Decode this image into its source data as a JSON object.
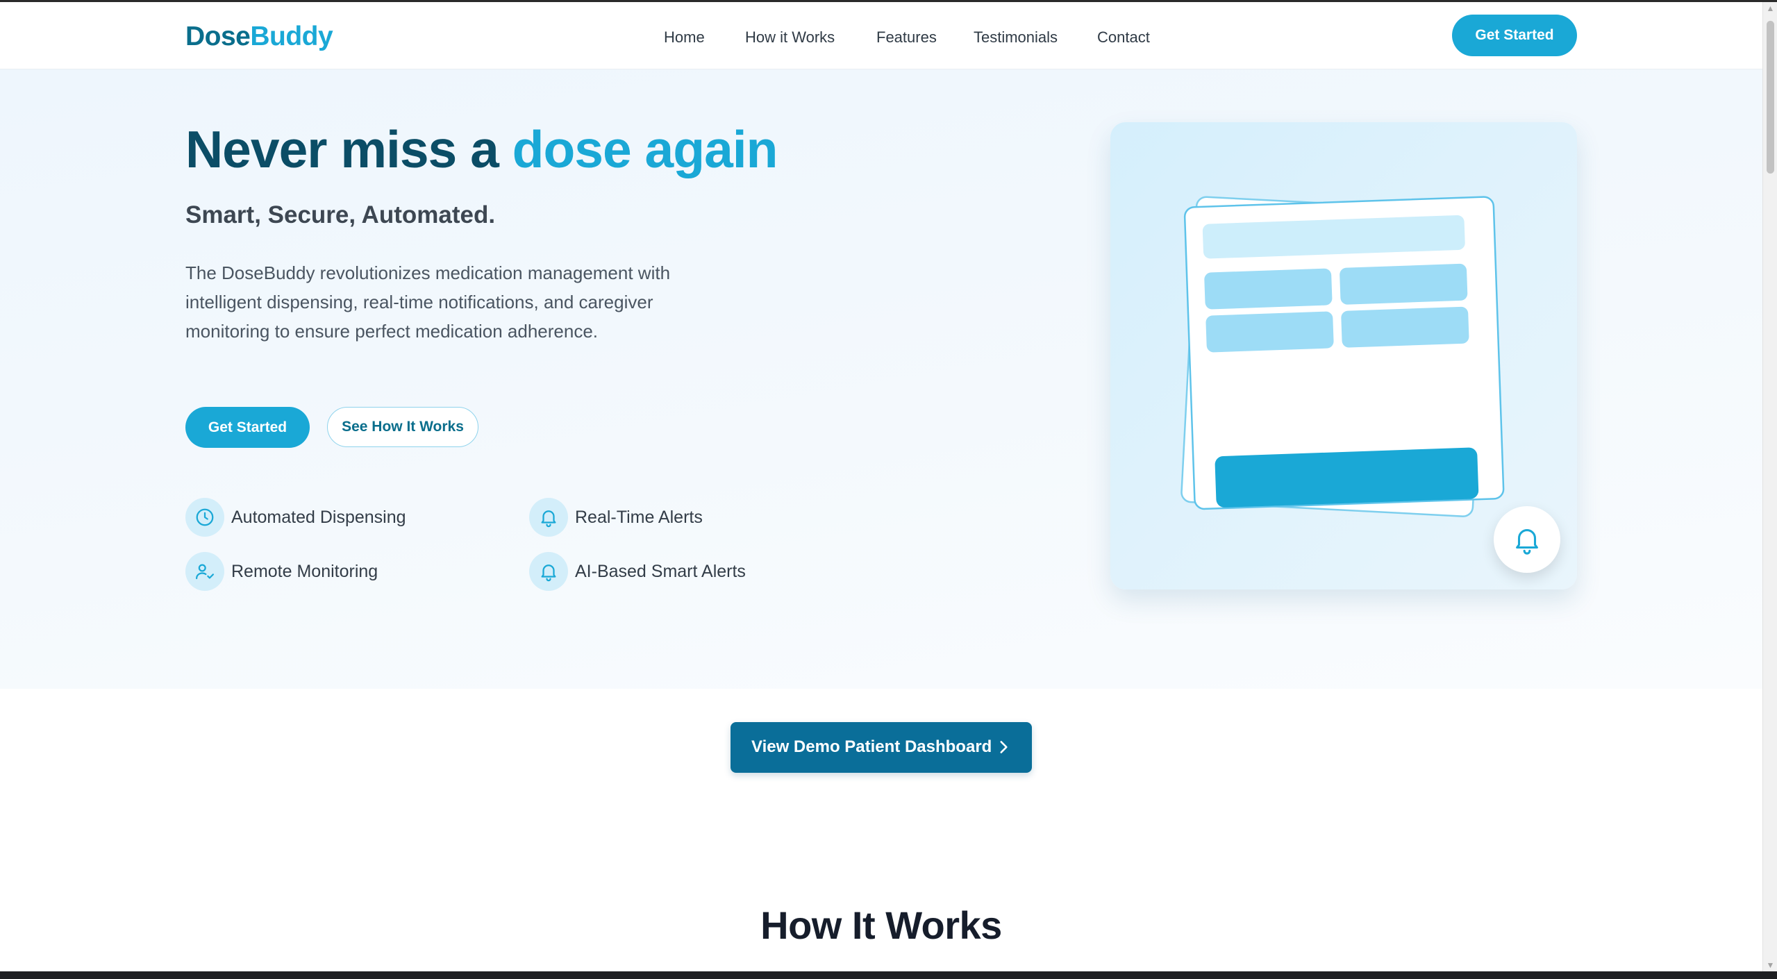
{
  "brand": {
    "part1": "Dose",
    "part2": "Buddy",
    "colors": {
      "primary_dark": "#0a6e8c",
      "accent": "#1aa8d6",
      "heading": "#0b4d66"
    }
  },
  "nav": {
    "items": [
      {
        "label": "Home"
      },
      {
        "label": "How it Works"
      },
      {
        "label": "Features"
      },
      {
        "label": "Testimonials"
      },
      {
        "label": "Contact"
      }
    ],
    "cta": "Get Started"
  },
  "hero": {
    "title_part1": "Never miss a ",
    "title_accent": "dose again",
    "subtitle": "Smart, Secure, Automated.",
    "description": "The DoseBuddy revolutionizes medication management with intelligent dispensing, real-time notifications, and caregiver monitoring to ensure perfect medication adherence.",
    "primary_button": "Get Started",
    "secondary_button": "See How It Works",
    "features": [
      {
        "label": "Automated Dispensing",
        "icon": "clock-icon"
      },
      {
        "label": "Real-Time Alerts",
        "icon": "bell-icon"
      },
      {
        "label": "Remote Monitoring",
        "icon": "user-check-icon"
      },
      {
        "label": "AI-Based Smart Alerts",
        "icon": "bell-icon"
      }
    ]
  },
  "illustration": {
    "badge_icon": "bell-icon"
  },
  "demo": {
    "label": "View Demo Patient Dashboard",
    "icon": "chevron-right-icon"
  },
  "how_it_works": {
    "title": "How It Works"
  }
}
